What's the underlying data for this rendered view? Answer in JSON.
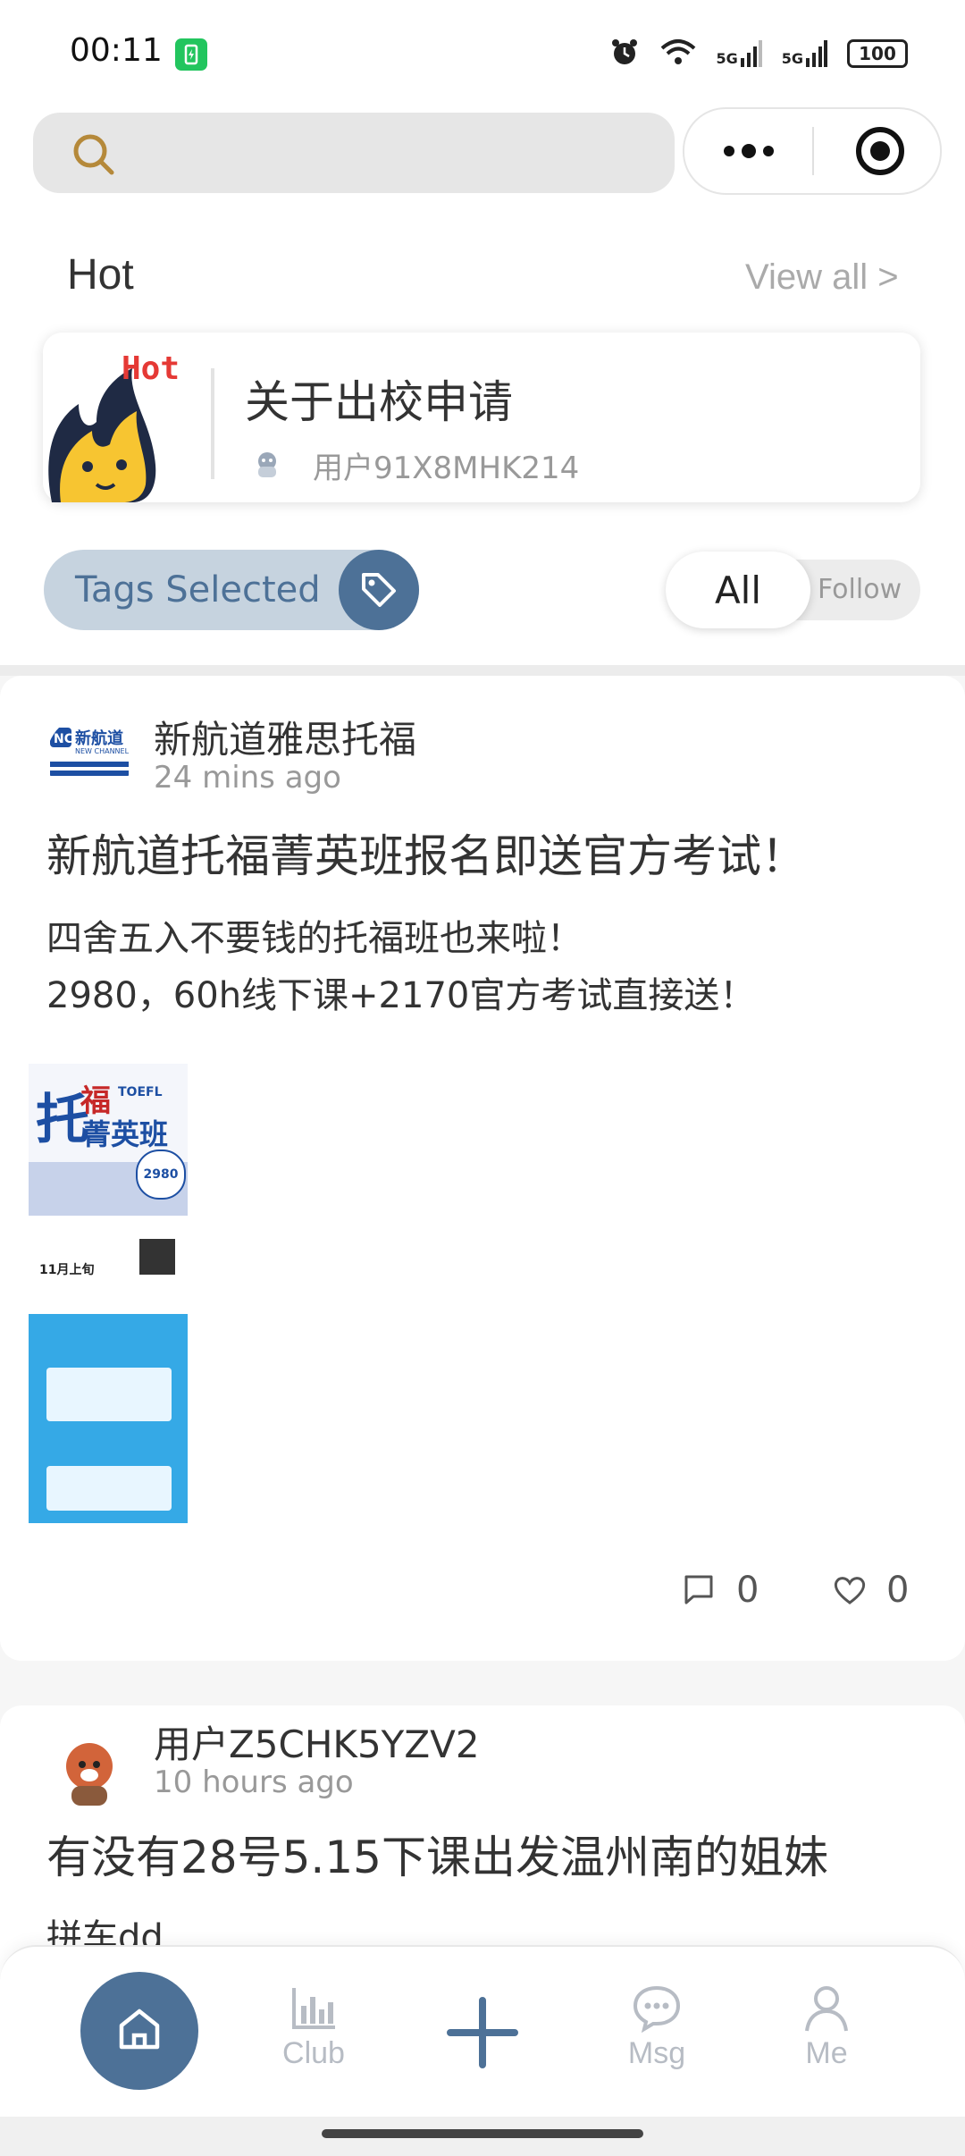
{
  "status_bar": {
    "time": "00:11",
    "battery": "100",
    "signal1": "5G",
    "signal2": "5G"
  },
  "hot": {
    "title": "Hot",
    "view_all": "View all >",
    "badge": "Hot",
    "post_title": "关于出校申请",
    "post_user": "用户91X8MHK214"
  },
  "filters": {
    "tags_label": "Tags Selected",
    "all_label": "All",
    "follow_label": "Follow"
  },
  "posts": [
    {
      "author": "新航道雅思托福",
      "time": "24 mins ago",
      "title": "新航道托福菁英班报名即送官方考试！",
      "body_lines": [
        "四舍五入不要钱的托福班也来啦！",
        "2980，60h线下课+2170官方考试直接送！"
      ],
      "comments": "0",
      "likes": "0",
      "avatar_text": "新航道",
      "avatar_subtext": "NEW CHANNEL",
      "poster": {
        "title_a": "托",
        "title_b": "福",
        "title_c": "菁英班",
        "price": "2980",
        "date": "11月上旬",
        "toefl": "TOEFL"
      }
    },
    {
      "author": "用户Z5CHK5YZV2",
      "time": "10 hours ago",
      "title": "有没有28号5.15下课出发温州南的姐妹",
      "body_preview": "拼车dd"
    }
  ],
  "tabbar": {
    "items": [
      {
        "label": "",
        "icon": "home-icon"
      },
      {
        "label": "Club",
        "icon": "bar-chart-icon"
      },
      {
        "label": "",
        "icon": "plus-icon"
      },
      {
        "label": "Msg",
        "icon": "chat-bubble-icon"
      },
      {
        "label": "Me",
        "icon": "person-icon"
      }
    ]
  },
  "colors": {
    "accent": "#4d7197",
    "hot_red": "#e53935",
    "muted": "#999999",
    "tab_inactive": "#b7bcc4"
  }
}
